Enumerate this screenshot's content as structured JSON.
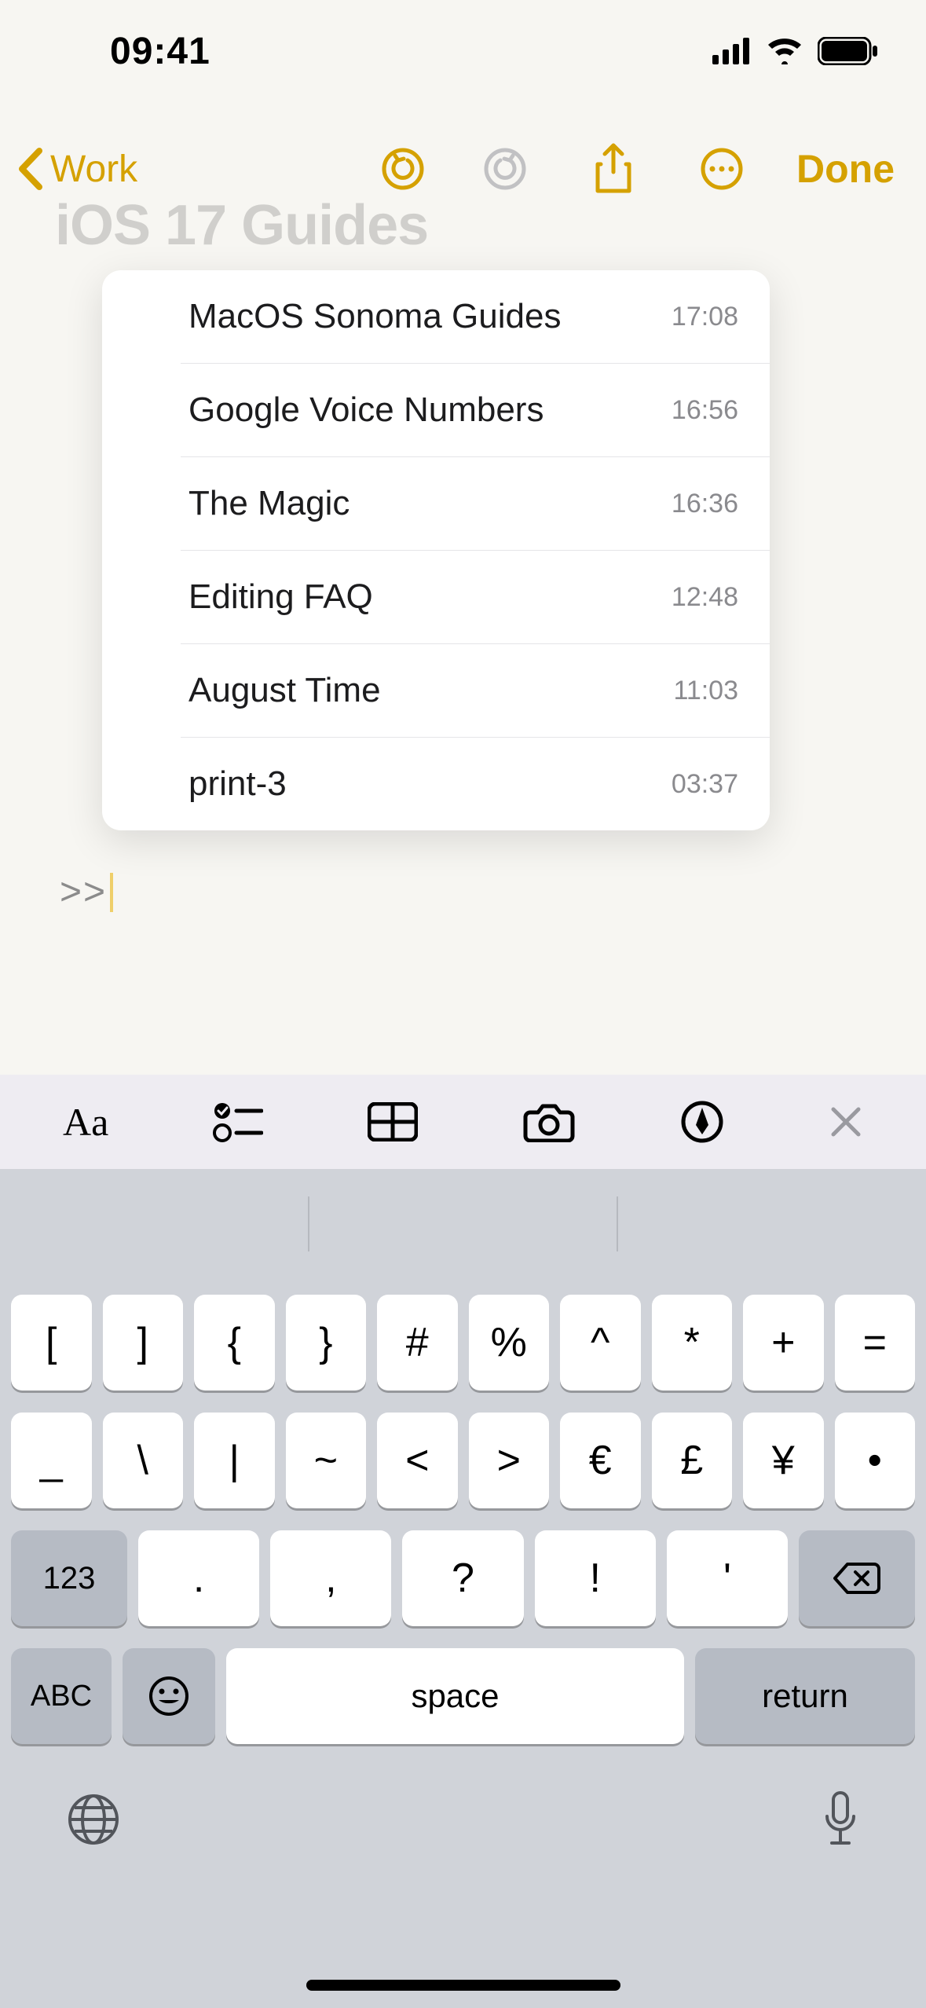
{
  "status": {
    "time": "09:41"
  },
  "nav": {
    "back_label": "Work",
    "done_label": "Done"
  },
  "ghost_title": "iOS 17 Guides",
  "note_prefix": ">>",
  "suggestions": [
    {
      "title": "MacOS Sonoma Guides",
      "time": "17:08"
    },
    {
      "title": "Google Voice Numbers",
      "time": "16:56"
    },
    {
      "title": "The Magic",
      "time": "16:36"
    },
    {
      "title": "Editing FAQ",
      "time": "12:48"
    },
    {
      "title": "August Time",
      "time": "11:03"
    },
    {
      "title": "print-3",
      "time": "03:37"
    }
  ],
  "toolbar": {
    "text_style": "Aa"
  },
  "keyboard": {
    "row1": [
      "[",
      "]",
      "{",
      "}",
      "#",
      "%",
      "^",
      "*",
      "+",
      "="
    ],
    "row2": [
      "_",
      "\\",
      "|",
      "~",
      "<",
      ">",
      "€",
      "£",
      "¥",
      "•"
    ],
    "row3_mod": "123",
    "row3": [
      ".",
      ",",
      "?",
      "!",
      "'"
    ],
    "abc": "ABC",
    "space": "space",
    "return": "return"
  }
}
